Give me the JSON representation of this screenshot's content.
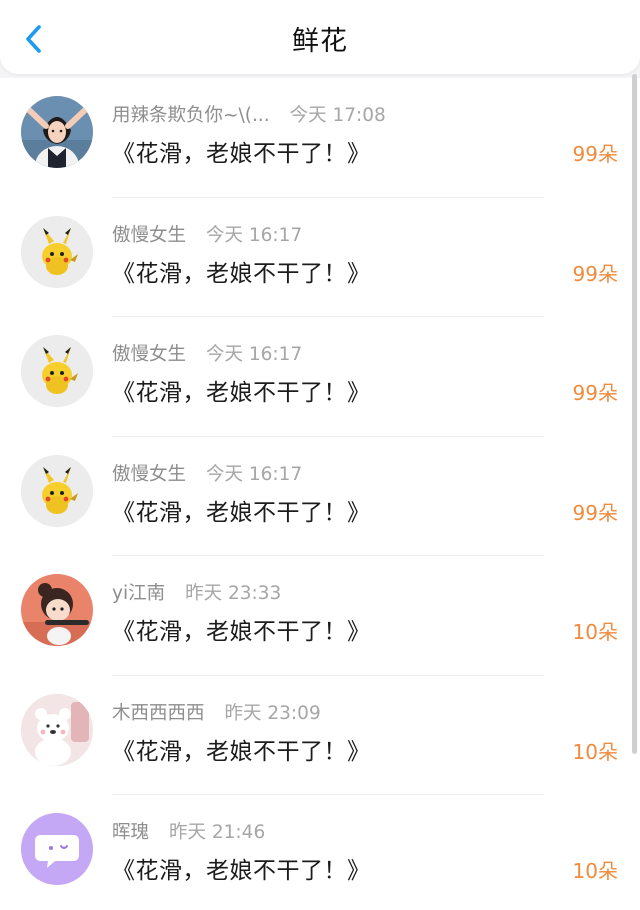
{
  "header": {
    "title": "鲜花",
    "back_icon": "chevron-left-icon",
    "accent": "#1e9bf0"
  },
  "items": [
    {
      "name": "用辣条欺负你~\\(...",
      "time": "今天 17:08",
      "message": "《花滑，老娘不干了！》",
      "count": "99朵",
      "avatar": "girl-photo"
    },
    {
      "name": "傲慢女生",
      "time": "今天 16:17",
      "message": "《花滑，老娘不干了！》",
      "count": "99朵",
      "avatar": "pikachu"
    },
    {
      "name": "傲慢女生",
      "time": "今天 16:17",
      "message": "《花滑，老娘不干了！》",
      "count": "99朵",
      "avatar": "pikachu"
    },
    {
      "name": "傲慢女生",
      "time": "今天 16:17",
      "message": "《花滑，老娘不干了！》",
      "count": "99朵",
      "avatar": "pikachu"
    },
    {
      "name": "yi江南",
      "time": "昨天 23:33",
      "message": "《花滑，老娘不干了！》",
      "count": "10朵",
      "avatar": "cartoon-girl"
    },
    {
      "name": "木西西西西",
      "time": "昨天 23:09",
      "message": "《花滑，老娘不干了！》",
      "count": "10朵",
      "avatar": "white-bear"
    },
    {
      "name": "晖瑰",
      "time": "昨天 21:46",
      "message": "《花滑，老娘不干了！》",
      "count": "10朵",
      "avatar": "chat-bubble"
    }
  ],
  "colors": {
    "count": "#f08a3c",
    "name": "#8e8e8e",
    "message": "#1c1c1c"
  }
}
